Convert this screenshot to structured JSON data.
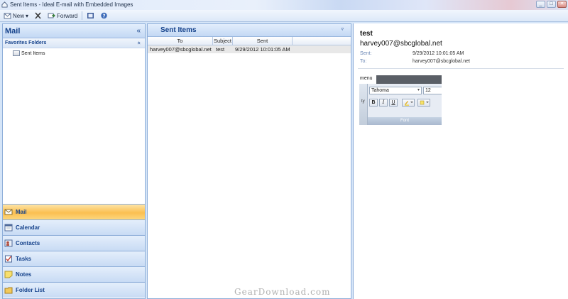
{
  "window": {
    "title": "Sent Items - Ideal E-mail with Embedded Images",
    "controls": [
      "_",
      "□",
      "✕"
    ]
  },
  "toolbar": {
    "new_label": "New",
    "new_arrow": "▾",
    "forward_label": "Forward"
  },
  "nav": {
    "title": "Mail",
    "collapse_glyph": "«",
    "favorites_title": "Favorites Folders",
    "favorites_glyph": "«",
    "folders": [
      "Sent Items"
    ],
    "buttons": [
      {
        "label": "Mail",
        "icon": "mail-icon",
        "active": true
      },
      {
        "label": "Calendar",
        "icon": "calendar-icon",
        "active": false
      },
      {
        "label": "Contacts",
        "icon": "contacts-icon",
        "active": false
      },
      {
        "label": "Tasks",
        "icon": "tasks-icon",
        "active": false
      },
      {
        "label": "Notes",
        "icon": "notes-icon",
        "active": false
      },
      {
        "label": "Folder List",
        "icon": "folder-list-icon",
        "active": false
      }
    ]
  },
  "list": {
    "title": "Sent Items",
    "menu_glyph": "▿",
    "columns": [
      "To",
      "Subject",
      "Sent"
    ],
    "rows": [
      {
        "to": "harvey007@sbcglobal.net",
        "subject": "test",
        "sent": "9/29/2012 10:01:05 AM"
      }
    ]
  },
  "reading": {
    "subject": "test",
    "from": "harvey007@sbcglobal.net",
    "sent_label": "Sent:",
    "sent_value": "9/29/2012 10:01:05 AM",
    "to_label": "To:",
    "to_value": "harvey007@sbcglobal.net",
    "embedded": {
      "menu_label": "menu",
      "font_name": "Tahoma",
      "font_size": "12",
      "side_label": "ty",
      "bold": "B",
      "italic": "I",
      "underline": "U",
      "group_label": "Font"
    }
  },
  "watermark": "GearDownload.com",
  "colors": {
    "accent": "#15428b",
    "active_nav": "#fbbf50",
    "border": "#8eaed9"
  }
}
